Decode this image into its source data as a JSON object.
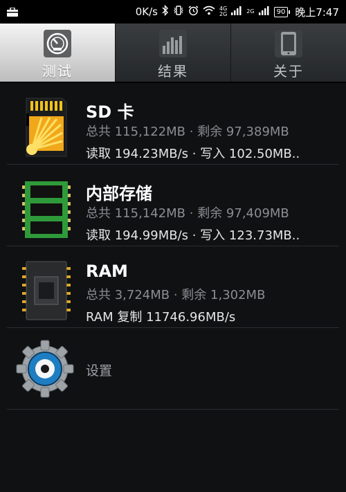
{
  "status_bar": {
    "speed": "0K/s",
    "network_top": "4G",
    "network_bottom": "2G",
    "network2": "2G",
    "battery": "90",
    "time": "晚上7:47"
  },
  "tabs": [
    {
      "label": "测试",
      "icon": "speedometer-icon",
      "active": true
    },
    {
      "label": "结果",
      "icon": "bar-chart-icon",
      "active": false
    },
    {
      "label": "关于",
      "icon": "phone-icon",
      "active": false
    }
  ],
  "items": [
    {
      "title": "SD 卡",
      "total": "总共 115,122MB · 剩余 97,389MB",
      "speed": "读取 194.23MB/s · 写入 102.50MB..",
      "icon": "sd-card-icon"
    },
    {
      "title": "内部存储",
      "total": "总共 115,142MB · 剩余 97,409MB",
      "speed": "读取 194.99MB/s · 写入 123.73MB..",
      "icon": "internal-storage-icon"
    },
    {
      "title": "RAM",
      "total": "总共 3,724MB · 剩余 1,302MB",
      "speed": "RAM 复制 11746.96MB/s",
      "icon": "ram-chip-icon"
    }
  ],
  "settings": {
    "label": "设置",
    "icon": "gear-icon"
  },
  "colors": {
    "accent_yellow": "#f2c316",
    "storage_green": "#2f9a3a",
    "background": "#0f1113"
  }
}
